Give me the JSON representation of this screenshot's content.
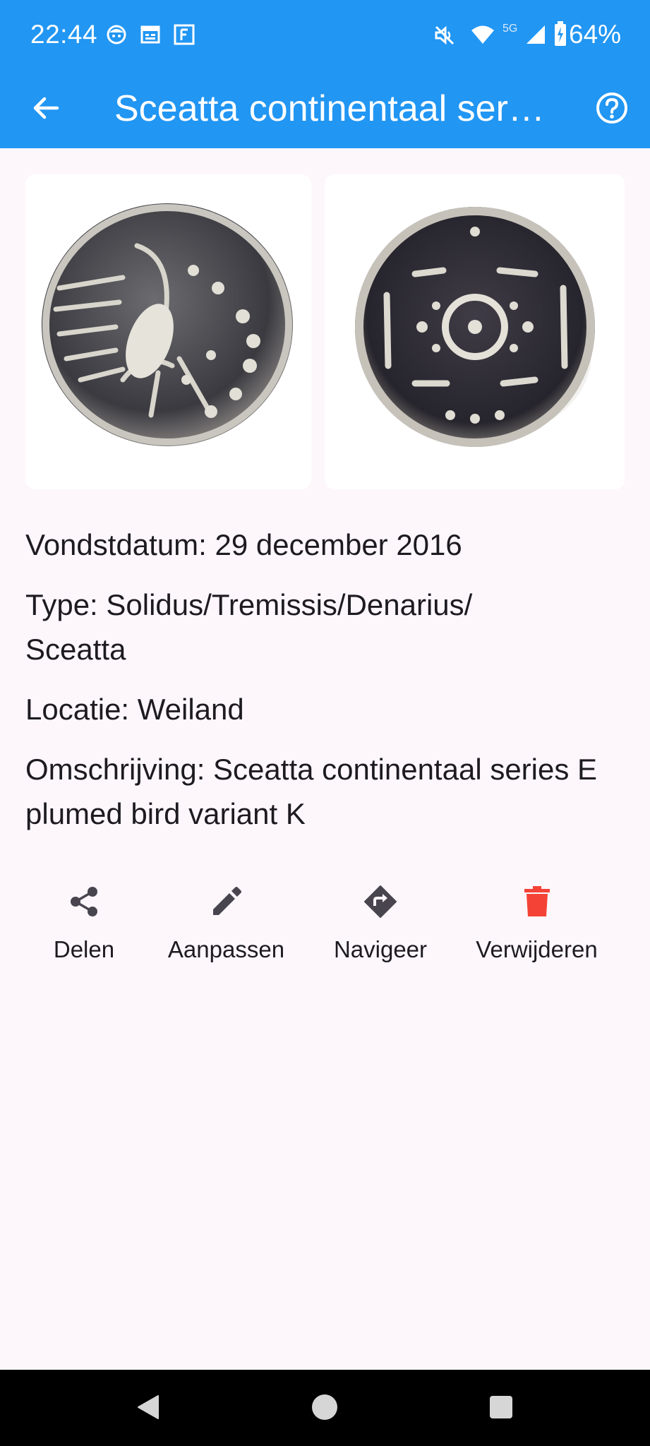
{
  "status_bar": {
    "time": "22:44",
    "network": "5G",
    "battery": "64%",
    "left_icons": [
      "face-notification-icon",
      "calendar-notification-icon",
      "f-app-notification-icon"
    ],
    "right_icons": [
      "mute-icon",
      "wifi-icon",
      "signal-icon",
      "battery-charging-icon"
    ]
  },
  "app_bar": {
    "title": "Sceatta continentaal series E plumed bird variant K",
    "back_icon": "arrow-back-icon",
    "help_icon": "help-circle-icon",
    "color": "#2196f3"
  },
  "photos": [
    {
      "name": "obverse",
      "icon": "coin-obverse-image"
    },
    {
      "name": "reverse",
      "icon": "coin-reverse-image"
    }
  ],
  "details": {
    "date": "Vondstdatum: 29 december 2016",
    "type": "Type: Solidus/Tremissis/Denarius/ Sceatta",
    "location": "Locatie: Weiland",
    "description": "Omschrijving: Sceatta continentaal series E plumed bird variant K"
  },
  "actions": [
    {
      "label": "Delen",
      "icon": "share-icon",
      "color": "#49454f"
    },
    {
      "label": "Aanpassen",
      "icon": "edit-pencil-icon",
      "color": "#49454f"
    },
    {
      "label": "Navigeer",
      "icon": "directions-icon",
      "color": "#49454f"
    },
    {
      "label": "Verwijderen",
      "icon": "delete-icon",
      "color": "#f44336"
    }
  ],
  "nav_bar": {
    "icons": [
      "nav-back-icon",
      "nav-home-icon",
      "nav-recents-icon"
    ]
  }
}
